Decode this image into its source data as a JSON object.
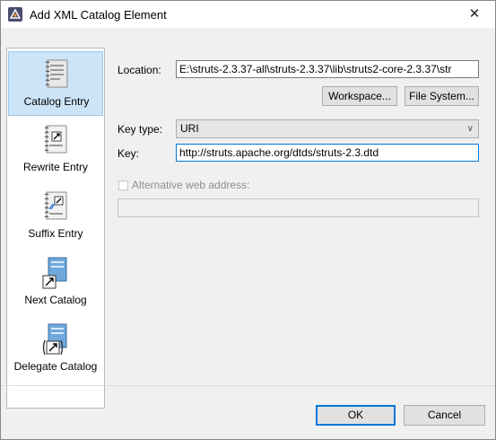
{
  "window": {
    "title": "Add XML Catalog Element",
    "app_icon": "eclipse-icon",
    "close_glyph": "✕"
  },
  "sidebar": {
    "items": [
      {
        "label": "Catalog Entry",
        "icon": "catalog-entry-icon",
        "selected": true
      },
      {
        "label": "Rewrite Entry",
        "icon": "rewrite-entry-icon",
        "selected": false
      },
      {
        "label": "Suffix Entry",
        "icon": "suffix-entry-icon",
        "selected": false
      },
      {
        "label": "Next Catalog",
        "icon": "next-catalog-icon",
        "selected": false
      },
      {
        "label": "Delegate Catalog",
        "icon": "delegate-catalog-icon",
        "selected": false
      }
    ]
  },
  "form": {
    "location_label": "Location:",
    "location_value": "E:\\struts-2.3.37-all\\struts-2.3.37\\lib\\struts2-core-2.3.37\\str",
    "workspace_button": "Workspace...",
    "filesystem_button": "File System...",
    "key_type_label": "Key type:",
    "key_type_value": "URI",
    "key_label": "Key:",
    "key_value": "http://struts.apache.org/dtds/struts-2.3.dtd",
    "alt_web_label": "Alternative web address:",
    "alt_web_checked": false,
    "alt_web_value": ""
  },
  "footer": {
    "ok_button": "OK",
    "cancel_button": "Cancel"
  },
  "colors": {
    "selection_bg": "#cce4f7",
    "accent": "#0078d7"
  }
}
